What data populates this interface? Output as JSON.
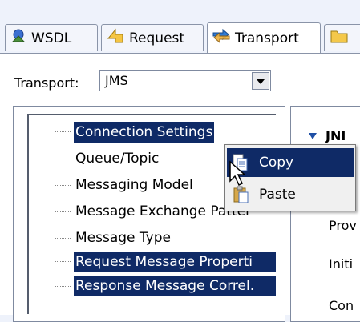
{
  "tabs": [
    {
      "label": "WSDL",
      "icon": "wsdl-icon"
    },
    {
      "label": "Request",
      "icon": "request-icon"
    },
    {
      "label": "Transport",
      "icon": "transport-icon",
      "active": true
    },
    {
      "label": "",
      "icon": "folder-icon"
    }
  ],
  "transport": {
    "label": "Transport:",
    "value": "JMS"
  },
  "tree": {
    "items": [
      {
        "label": "Connection Settings",
        "selected": true
      },
      {
        "label": "Queue/Topic",
        "selected": false
      },
      {
        "label": "Messaging Model",
        "selected": false
      },
      {
        "label": "Message Exchange Patter",
        "selected": false
      },
      {
        "label": "Message Type",
        "selected": false
      },
      {
        "label": "Request Message Properti",
        "selected": true
      },
      {
        "label": "Response Message Correl.",
        "selected": true
      }
    ]
  },
  "right_panel": {
    "header": "JNI",
    "rows": [
      "Prov",
      "Initi",
      "Con"
    ]
  },
  "context_menu": {
    "items": [
      {
        "label": "Copy",
        "icon": "copy-icon",
        "highlighted": true
      },
      {
        "label": "Paste",
        "icon": "paste-icon",
        "highlighted": false
      }
    ]
  },
  "colors": {
    "selection": "#0f2a66",
    "background": "#eef2fb"
  }
}
